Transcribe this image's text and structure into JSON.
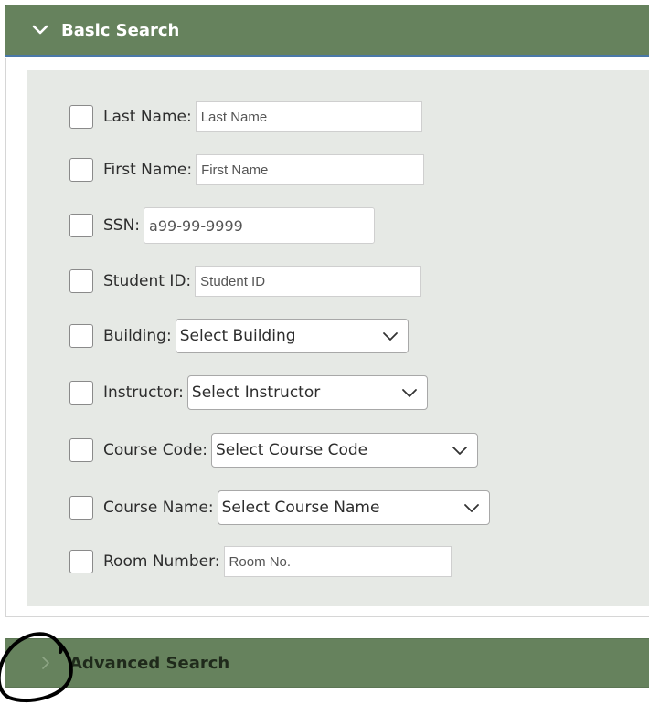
{
  "basic_search": {
    "title": "Basic Search",
    "fields": [
      {
        "label": "Last Name:",
        "type": "text",
        "placeholder": "Last Name"
      },
      {
        "label": "First Name:",
        "type": "text",
        "placeholder": "First Name"
      },
      {
        "label": "SSN:",
        "type": "text",
        "placeholder": "a99-99-9999"
      },
      {
        "label": "Student ID:",
        "type": "text",
        "placeholder": "Student ID"
      },
      {
        "label": "Building:",
        "type": "select",
        "selected": "Select Building"
      },
      {
        "label": "Instructor:",
        "type": "select",
        "selected": "Select Instructor"
      },
      {
        "label": "Course Code:",
        "type": "select",
        "selected": "Select Course Code"
      },
      {
        "label": "Course Name:",
        "type": "select",
        "selected": "Select Course Name"
      },
      {
        "label": "Room Number:",
        "type": "text",
        "placeholder": "Room No."
      }
    ]
  },
  "advanced_search": {
    "title": "Advanced Search"
  },
  "icons": {
    "basic_header": "chevron-down-icon",
    "advanced_header": "chevron-right-icon",
    "select_arrow": "chevron-down-icon"
  },
  "colors": {
    "header_bg": "#66825d",
    "form_bg": "#e6e9e5",
    "header_accent": "#4a78a8"
  }
}
